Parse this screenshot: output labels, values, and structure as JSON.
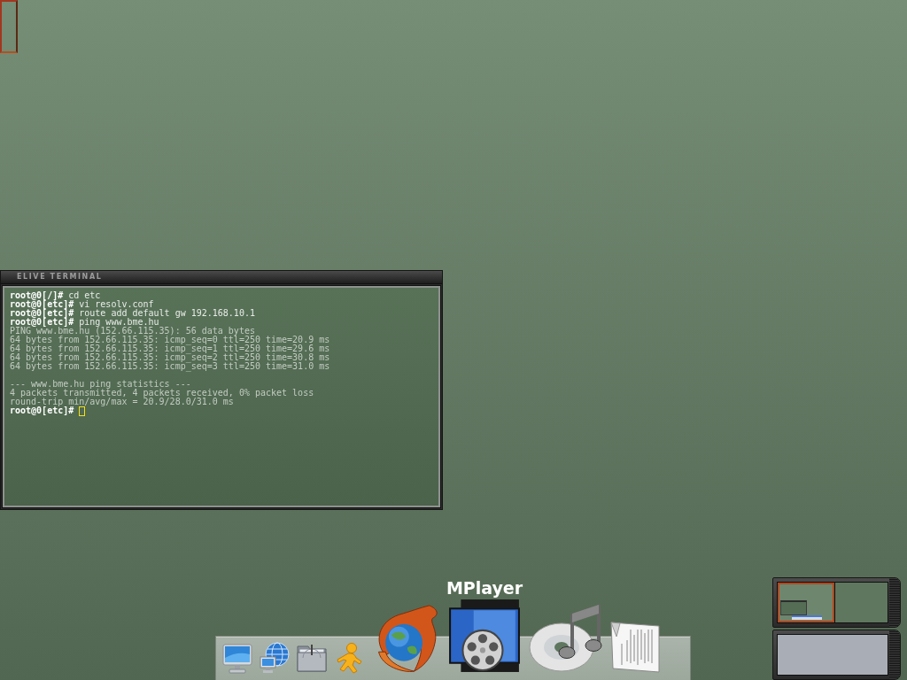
{
  "terminal": {
    "title": "ELIVE TERMINAL",
    "sections": [
      {
        "lines": [
          {
            "kind": "prompt",
            "text": "**root@0[/]#** cd etc",
            "cursor": false
          },
          {
            "kind": "prompt",
            "text": "**root@0[etc]#** vi resolv.conf",
            "cursor": false
          },
          {
            "kind": "prompt",
            "text": "**root@0[etc]#** route add default gw 192.168.10.1",
            "cursor": false
          },
          {
            "kind": "prompt",
            "text": "**root@0[etc]#** ping www.bme.hu",
            "cursor": false
          },
          {
            "kind": "output",
            "text": "PING www.bme.hu (152.66.115.35): 56 data bytes",
            "cursor": false
          },
          {
            "kind": "output",
            "text": "64 bytes from 152.66.115.35: icmp_seq=0 ttl=250 time=20.9 ms",
            "cursor": false
          },
          {
            "kind": "output",
            "text": "64 bytes from 152.66.115.35: icmp_seq=1 ttl=250 time=29.6 ms",
            "cursor": false
          },
          {
            "kind": "output",
            "text": "64 bytes from 152.66.115.35: icmp_seq=2 ttl=250 time=30.8 ms",
            "cursor": false
          },
          {
            "kind": "output",
            "text": "64 bytes from 152.66.115.35: icmp_seq=3 ttl=250 time=31.0 ms",
            "cursor": false
          }
        ]
      },
      {
        "lines": [
          {
            "kind": "output",
            "text": "--- www.bme.hu ping statistics ---",
            "cursor": false
          },
          {
            "kind": "output",
            "text": "4 packets transmitted, 4 packets received, 0% packet loss",
            "cursor": false
          },
          {
            "kind": "output",
            "text": "round-trip min/avg/max = 20.9/28.0/31.0 ms",
            "cursor": false
          },
          {
            "kind": "prompt",
            "text": "**root@0[etc]#**",
            "cursor": true
          }
        ]
      }
    ]
  },
  "dock": {
    "items": [
      {
        "kind": "monitor",
        "magnified": false
      },
      {
        "kind": "network",
        "magnified": false
      },
      {
        "kind": "folder",
        "magnified": false
      },
      {
        "kind": "messenger",
        "magnified": false
      },
      {
        "kind": "browser",
        "magnified": true
      },
      {
        "kind": "video",
        "magnified": true,
        "label": "MPlayer"
      },
      {
        "kind": "music",
        "magnified": true
      },
      {
        "kind": "document",
        "magnified": true
      }
    ]
  },
  "pager": {
    "desks": [
      {
        "selected": true,
        "windows": true
      },
      {
        "selected": false,
        "windows": false
      }
    ]
  }
}
